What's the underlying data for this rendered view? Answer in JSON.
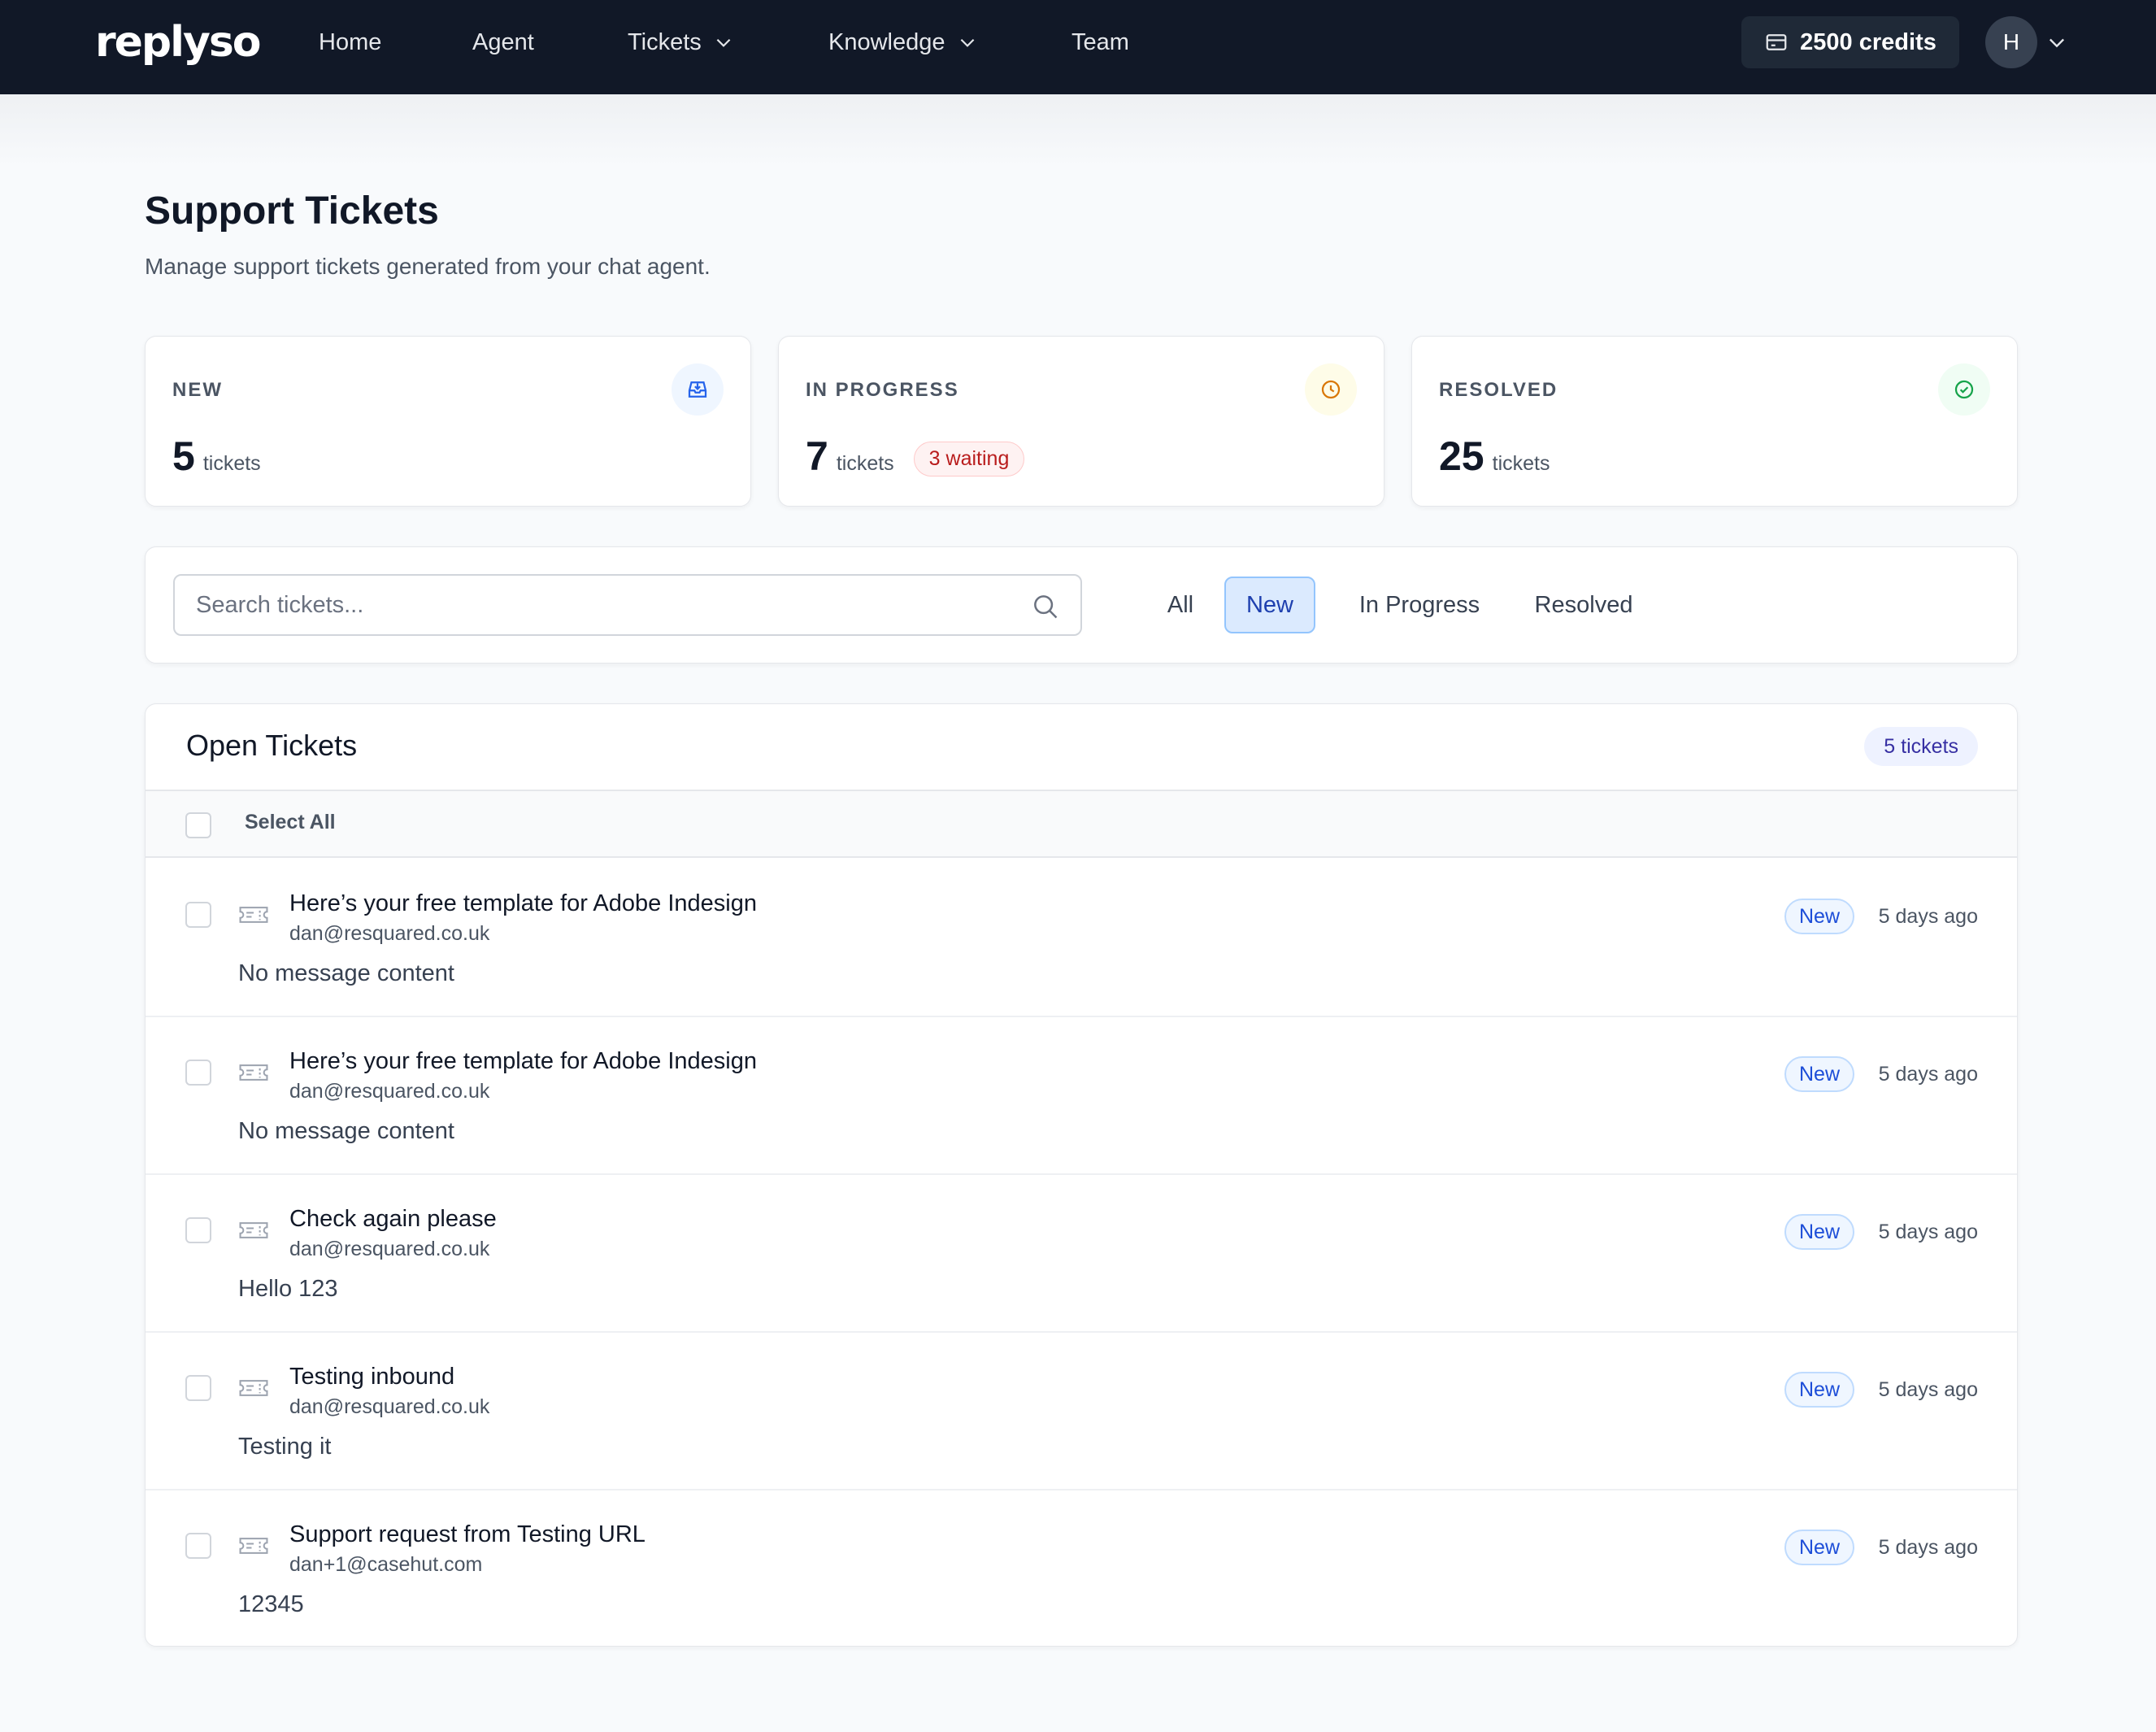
{
  "nav": {
    "logo": "replyso",
    "links": [
      "Home",
      "Agent",
      "Tickets",
      "Knowledge",
      "Team"
    ],
    "credits": "2500 credits",
    "avatar_initial": "H"
  },
  "header": {
    "title": "Support Tickets",
    "subtitle": "Manage support tickets generated from your chat agent."
  },
  "stats": [
    {
      "label": "NEW",
      "value": "5",
      "unit": "tickets",
      "icon": "inbox-icon",
      "color": "#2563eb"
    },
    {
      "label": "IN PROGRESS",
      "value": "7",
      "unit": "tickets",
      "badge": "3 waiting",
      "icon": "clock-icon",
      "color": "#d97706"
    },
    {
      "label": "RESOLVED",
      "value": "25",
      "unit": "tickets",
      "icon": "check-circle-icon",
      "color": "#16a34a"
    }
  ],
  "filters": {
    "search_placeholder": "Search tickets...",
    "tabs": [
      "All",
      "New",
      "In Progress",
      "Resolved"
    ],
    "active_tab": "New"
  },
  "tickets_panel": {
    "title": "Open Tickets",
    "count_badge": "5 tickets",
    "select_all": "Select All",
    "rows": [
      {
        "title": "Here’s your free template for Adobe Indesign",
        "email": "dan@resquared.co.uk",
        "message": "No message content",
        "status": "New",
        "time": "5 days ago"
      },
      {
        "title": "Here’s your free template for Adobe Indesign",
        "email": "dan@resquared.co.uk",
        "message": "No message content",
        "status": "New",
        "time": "5 days ago"
      },
      {
        "title": "Check again please",
        "email": "dan@resquared.co.uk",
        "message": "Hello 123",
        "status": "New",
        "time": "5 days ago"
      },
      {
        "title": "Testing inbound",
        "email": "dan@resquared.co.uk",
        "message": "Testing it",
        "status": "New",
        "time": "5 days ago"
      },
      {
        "title": "Support request from Testing URL",
        "email": "dan+1@casehut.com",
        "message": "12345",
        "status": "New",
        "time": "5 days ago"
      }
    ]
  }
}
